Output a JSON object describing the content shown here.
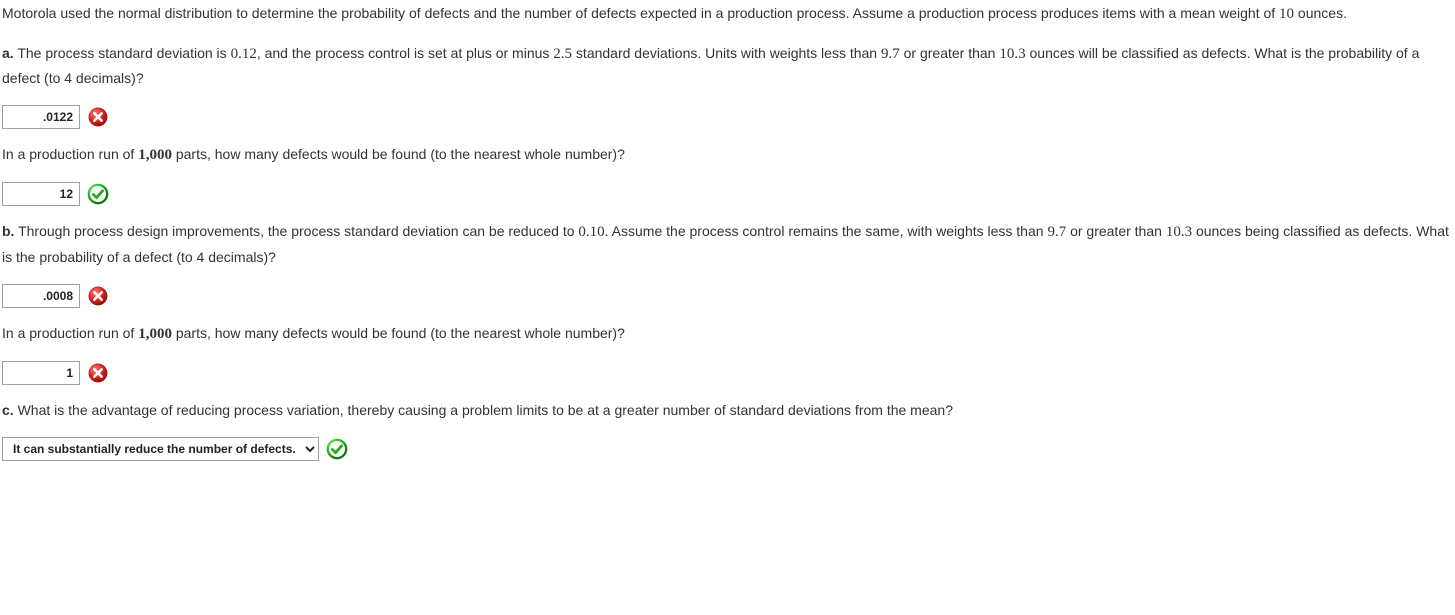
{
  "intro": {
    "text_before_mean": "Motorola used the normal distribution to determine the probability of defects and the number of defects expected in a production process. Assume a production process produces items with a mean weight of ",
    "mean": "10",
    "text_after_mean": " ounces."
  },
  "a": {
    "label": "a.",
    "t1": " The process standard deviation is ",
    "sd": "0.12",
    "t2": ", and the process control is set at plus or minus ",
    "pm": "2.5",
    "t3": " standard deviations. Units with weights less than ",
    "lo": "9.7",
    "t4": " or greater than ",
    "hi": "10.3",
    "t5": " ounces will be classified as defects. What is the probability of a defect (to 4 decimals)?",
    "ans1": ".0122",
    "q2_t1": "In a production run of ",
    "q2_n": "1,000",
    "q2_t2": " parts, how many defects would be found (to the nearest whole number)?",
    "ans2": "12"
  },
  "b": {
    "label": "b.",
    "t1": " Through process design improvements, the process standard deviation can be reduced to ",
    "sd": "0.10",
    "t2": ". Assume the process control remains the same, with weights less than ",
    "lo": "9.7",
    "t3": " or greater than ",
    "hi": "10.3",
    "t4": " ounces being classified as defects. What is the probability of a defect (to 4 decimals)?",
    "ans1": ".0008",
    "q2_t1": "In a production run of ",
    "q2_n": "1,000",
    "q2_t2": " parts, how many defects would be found (to the nearest whole number)?",
    "ans2": "1"
  },
  "c": {
    "label": "c.",
    "t1": " What is the advantage of reducing process variation, thereby causing a problem limits to be at a greater number of standard deviations from the mean?",
    "ans": "It can substantially reduce the number of defects."
  }
}
